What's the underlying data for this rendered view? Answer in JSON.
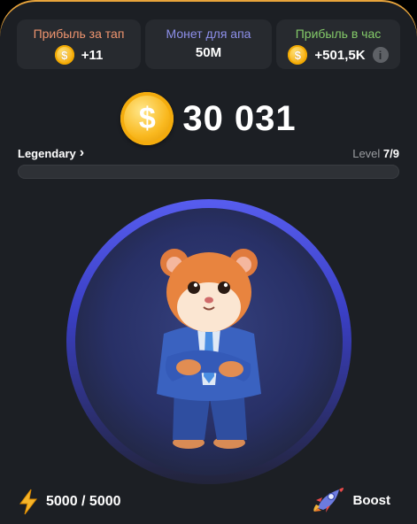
{
  "stats": [
    {
      "label": "Прибыль за тап",
      "value": "+11",
      "color": "#f0956f",
      "coin": true,
      "info": false
    },
    {
      "label": "Монет для апа",
      "value": "50M",
      "color": "#8d8fea",
      "coin": false,
      "info": false
    },
    {
      "label": "Прибыль в час",
      "value": "+501,5K",
      "color": "#84cb69",
      "coin": true,
      "info": true
    }
  ],
  "balance": {
    "value": "30 031",
    "coin_symbol": "$"
  },
  "league": {
    "name": "Legendary",
    "chevron": "›"
  },
  "level": {
    "label": "Level",
    "value": "7/9",
    "progress": 0.0
  },
  "energy": {
    "value": "5000 / 5000",
    "icon": "lightning-icon"
  },
  "boost": {
    "label": "Boost",
    "icon": "rocket-icon"
  },
  "character": {
    "icon": "hamster-ceo"
  },
  "colors": {
    "accent": "#e8a43b",
    "ring": "#575def",
    "coin": "#f7b31a"
  }
}
